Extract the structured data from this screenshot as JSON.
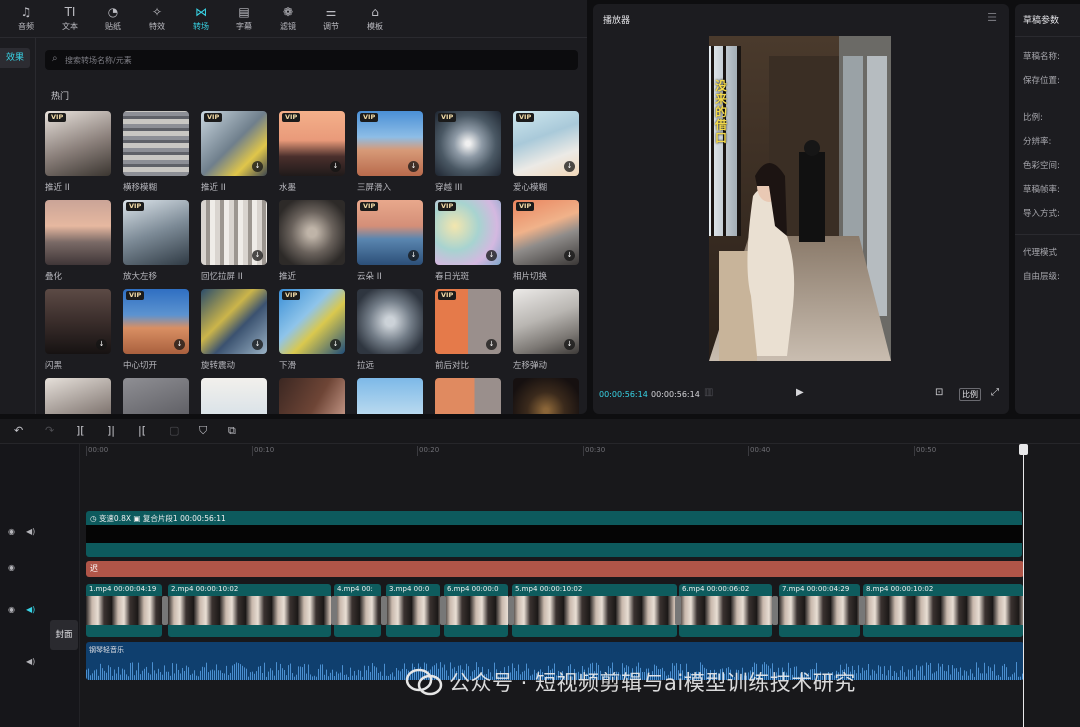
{
  "toolbar": {
    "items": [
      {
        "icon": "music-icon",
        "glyph": "♫",
        "label": "音频"
      },
      {
        "icon": "text-icon",
        "glyph": "TI",
        "label": "文本"
      },
      {
        "icon": "sticker-icon",
        "glyph": "◔",
        "label": "贴纸"
      },
      {
        "icon": "sparkle-icon",
        "glyph": "✧",
        "label": "特效"
      },
      {
        "icon": "transition-icon",
        "glyph": "⋈",
        "label": "转场",
        "active": true
      },
      {
        "icon": "caption-icon",
        "glyph": "▤",
        "label": "字幕"
      },
      {
        "icon": "filter-icon",
        "glyph": "❁",
        "label": "滤镜"
      },
      {
        "icon": "adjust-icon",
        "glyph": "⚌",
        "label": "调节"
      },
      {
        "icon": "template-icon",
        "glyph": "⌂",
        "label": "模板"
      }
    ]
  },
  "sidebar": {
    "tab_label": "效果"
  },
  "search": {
    "placeholder": "搜索转场名称/元素"
  },
  "section": {
    "title": "热门"
  },
  "tiles": [
    {
      "name": "推近 II",
      "vip": true,
      "download": false,
      "bg": "linear-gradient(160deg,#e8e2dc,#8a7f7a 55%,#3a3530)"
    },
    {
      "name": "横移模糊",
      "vip": false,
      "download": false,
      "bg": "repeating-linear-gradient(0deg,#8d8f96 0 4px,#c9c7c3 4px 9px,#5f6168 9px 12px)"
    },
    {
      "name": "推近 II",
      "vip": true,
      "download": true,
      "bg": "linear-gradient(135deg,#c9d6df,#6f7f8c 50%,#e0c64a 75%,#3d4650)"
    },
    {
      "name": "水墨",
      "vip": true,
      "download": true,
      "bg": "linear-gradient(180deg,#f4b08a,#e99a7a 45%,#4a2f2c 70%,#1f1a1a)"
    },
    {
      "name": "三屏滑入",
      "vip": true,
      "download": true,
      "bg": "linear-gradient(180deg,#4a8fd6,#8dbde6 40%,#d79a78 60%,#b86a4c)"
    },
    {
      "name": "穿越 III",
      "vip": true,
      "download": false,
      "bg": "radial-gradient(circle,#f0f0f0 5%,#8e9aa6 30%,#4a5864 60%,#1e2530)"
    },
    {
      "name": "爱心模糊",
      "vip": true,
      "download": true,
      "bg": "linear-gradient(160deg,#cfe8ef,#a9c9d9 40%,#eceae6 70%,#f1d7b8)"
    },
    {
      "name": "叠化",
      "vip": false,
      "download": false,
      "bg": "linear-gradient(180deg,#caa497,#e6b8a0 40%,#7a6a66 65%,#403638)"
    },
    {
      "name": "放大左移",
      "vip": true,
      "download": false,
      "bg": "linear-gradient(160deg,#dce4ea,#7c8a96 50%,#2f3a44)"
    },
    {
      "name": "回忆拉屏 II",
      "vip": false,
      "download": true,
      "bg": "repeating-linear-gradient(90deg,#d9d4cf 0 5px,#9c9690 5px 9px,#efece8 9px 14px)"
    },
    {
      "name": "推近",
      "vip": false,
      "download": false,
      "bg": "radial-gradient(circle,#bfb4a8 10%,#6a625c 45%,#2d2a28 80%)"
    },
    {
      "name": "云朵 II",
      "vip": true,
      "download": true,
      "bg": "linear-gradient(180deg,#e8a88c,#d48f78 40%,#5a86b0 60%,#2c4f78)"
    },
    {
      "name": "春日光斑",
      "vip": true,
      "download": true,
      "bg": "radial-gradient(circle at 30% 40%,#f3e6ae,#a7d3d0 40%,#d4b8e0 70%,#7fa7c9)"
    },
    {
      "name": "相片切换",
      "vip": true,
      "download": true,
      "bg": "linear-gradient(160deg,#e9845e,#f0b28a 40%,#8f8c8a 60%,#3a3736)"
    },
    {
      "name": "闪黑",
      "vip": false,
      "download": true,
      "bg": "linear-gradient(180deg,#5c4a45,#3a2d2b 50%,#161212)"
    },
    {
      "name": "中心切开",
      "vip": true,
      "download": true,
      "bg": "linear-gradient(180deg,#2f6fc2,#5c93d0 40%,#d98f63 60%,#a9603e)"
    },
    {
      "name": "旋转震动",
      "vip": false,
      "download": true,
      "bg": "linear-gradient(135deg,#2b4d6b,#cbb54a 40%,#3b5270 60%,#9ab2c5)"
    },
    {
      "name": "下滑",
      "vip": true,
      "download": true,
      "bg": "linear-gradient(135deg,#3a8fd6,#8fc4ea 40%,#d9c84e 60%,#204e7a)"
    },
    {
      "name": "拉远",
      "vip": false,
      "download": false,
      "bg": "radial-gradient(circle,#ccd2d8 10%,#737d88 45%,#2f3640 80%)"
    },
    {
      "name": "前后对比",
      "vip": true,
      "download": true,
      "bg": "linear-gradient(90deg,#e57a4a 0 50%,#9a8f8c 50% 100%)"
    },
    {
      "name": "左移弹动",
      "vip": false,
      "download": true,
      "bg": "linear-gradient(160deg,#eceae8,#b9b6b2 45%,#7c7874 75%,#3d3a38)"
    },
    {
      "name": "",
      "vip": false,
      "download": false,
      "bg": "linear-gradient(160deg,#e6e0da,#8a807b 60%,#3b3633)"
    },
    {
      "name": "",
      "vip": false,
      "download": false,
      "bg": "linear-gradient(160deg,#8f8f94,#4a4a50)"
    },
    {
      "name": "",
      "vip": false,
      "download": false,
      "bg": "linear-gradient(180deg,#f2f0ec,#d9e2e8 60%,#9fb7c8)"
    },
    {
      "name": "",
      "vip": false,
      "download": false,
      "bg": "linear-gradient(120deg,#3b2722,#6e4536 50%,#e5b6a5)"
    },
    {
      "name": "",
      "vip": false,
      "download": false,
      "bg": "linear-gradient(180deg,#7db9e8,#b8d9ef 55%,#2c5f8f)"
    },
    {
      "name": "",
      "vip": false,
      "download": false,
      "bg": "linear-gradient(90deg,#e08a60 0 60%,#9a8f8c 60% 100%)"
    },
    {
      "name": "",
      "vip": false,
      "download": false,
      "bg": "radial-gradient(circle,#8a6538 5%,#3b2a1c 40%,#161010 80%)"
    }
  ],
  "player": {
    "title": "播放器",
    "overlay_text": "没来的借口",
    "current_time": "00:00:56:14",
    "duration": "00:00:56:14",
    "ratio_label": "比例"
  },
  "params": {
    "title": "草稿参数",
    "labels": [
      "草稿名称:",
      "保存位置:",
      "比例:",
      "分辨率:",
      "色彩空间:",
      "草稿帧率:",
      "导入方式:",
      "代理模式",
      "自由层级:"
    ]
  },
  "timeline": {
    "ruler": [
      "00:00",
      "00:10",
      "00:20",
      "00:30",
      "00:40",
      "00:50"
    ],
    "cover_label": "封面",
    "fx_speed": "变速0.8X",
    "fx_name": "复合片段1",
    "fx_duration": "00:00:56:11",
    "text_clip": "迟",
    "clips": [
      {
        "label": "1.mp4   00:00:04:19"
      },
      {
        "label": "2.mp4   00:00:10:02"
      },
      {
        "label": "4.mp4   00:"
      },
      {
        "label": "3.mp4   00:0"
      },
      {
        "label": "6.mp4   00:00:0"
      },
      {
        "label": "5.mp4   00:00:10:02"
      },
      {
        "label": "6.mp4   00:00:06:02"
      },
      {
        "label": "7.mp4   00:00:04:29"
      },
      {
        "label": "8.mp4   00:00:10:02"
      }
    ],
    "audio_label": "钢琴轻音乐"
  },
  "watermark": {
    "text": "公众号 · 短视频剪辑与ai模型训练技术研究"
  },
  "colors": {
    "accent": "#38d4e6",
    "clip": "#0e5c5e",
    "text_track": "#b05548",
    "audio": "#0f3f6e"
  }
}
